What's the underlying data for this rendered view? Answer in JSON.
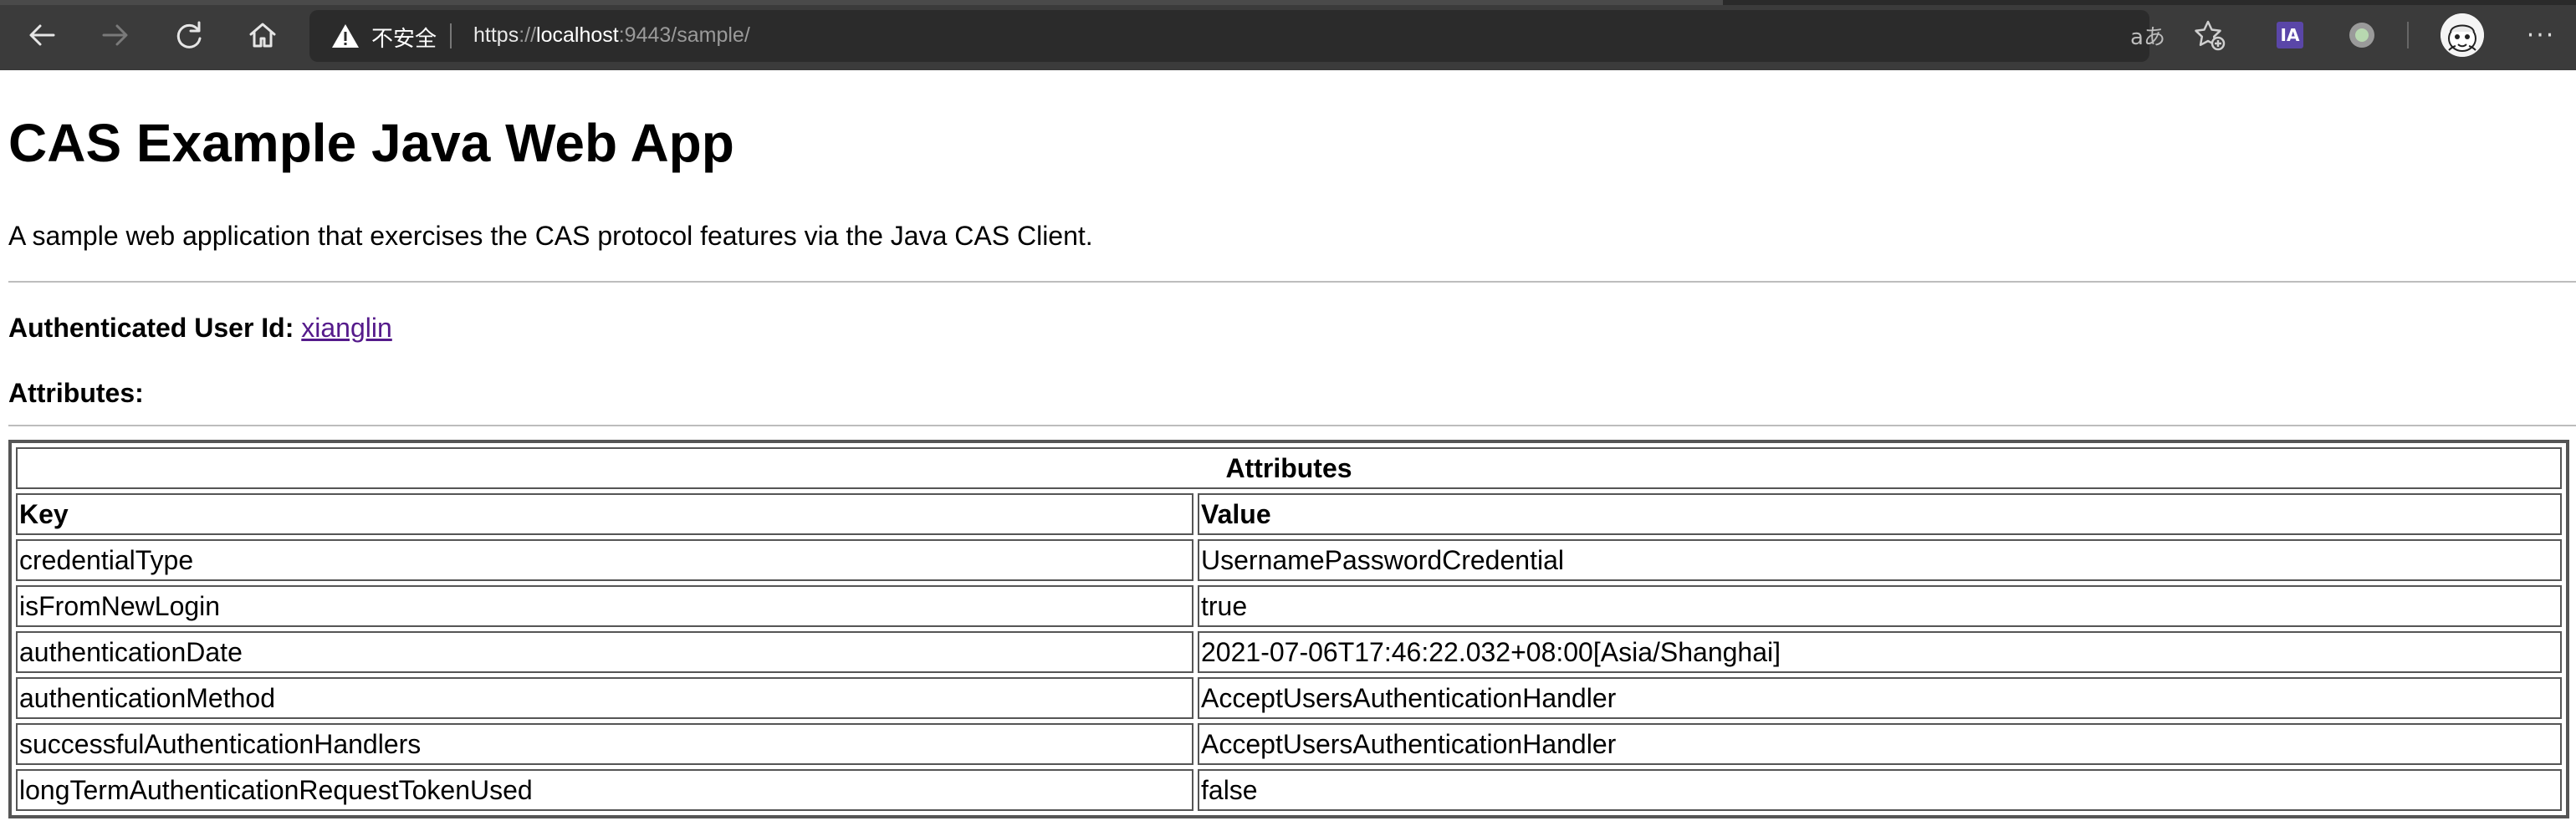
{
  "browser": {
    "address": {
      "security_label": "不安全",
      "url_scheme": "https",
      "url_sep": "://",
      "url_host": "localhost",
      "url_rest": ":9443/sample/"
    },
    "read_aloud_glyph": "aあ",
    "extension_ia_label": "IA",
    "more_label": "···"
  },
  "page": {
    "title": "CAS Example Java Web App",
    "description": "A sample web application that exercises the CAS protocol features via the Java CAS Client.",
    "user_label": "Authenticated User Id:",
    "user_id": "xianglin",
    "attributes_label": "Attributes:",
    "table": {
      "caption": "Attributes",
      "headers": [
        "Key",
        "Value"
      ],
      "rows": [
        {
          "key": "credentialType",
          "value": "UsernamePasswordCredential"
        },
        {
          "key": "isFromNewLogin",
          "value": "true"
        },
        {
          "key": "authenticationDate",
          "value": "2021-07-06T17:46:22.032+08:00[Asia/Shanghai]"
        },
        {
          "key": "authenticationMethod",
          "value": "AcceptUsersAuthenticationHandler"
        },
        {
          "key": "successfulAuthenticationHandlers",
          "value": "AcceptUsersAuthenticationHandler"
        },
        {
          "key": "longTermAuthenticationRequestTokenUsed",
          "value": "false"
        }
      ]
    }
  },
  "colors": {
    "toolbar_bg": "#3b3b3b",
    "address_bg": "#2b2b2b",
    "link_visited": "#551a8b",
    "table_border": "#555555"
  }
}
